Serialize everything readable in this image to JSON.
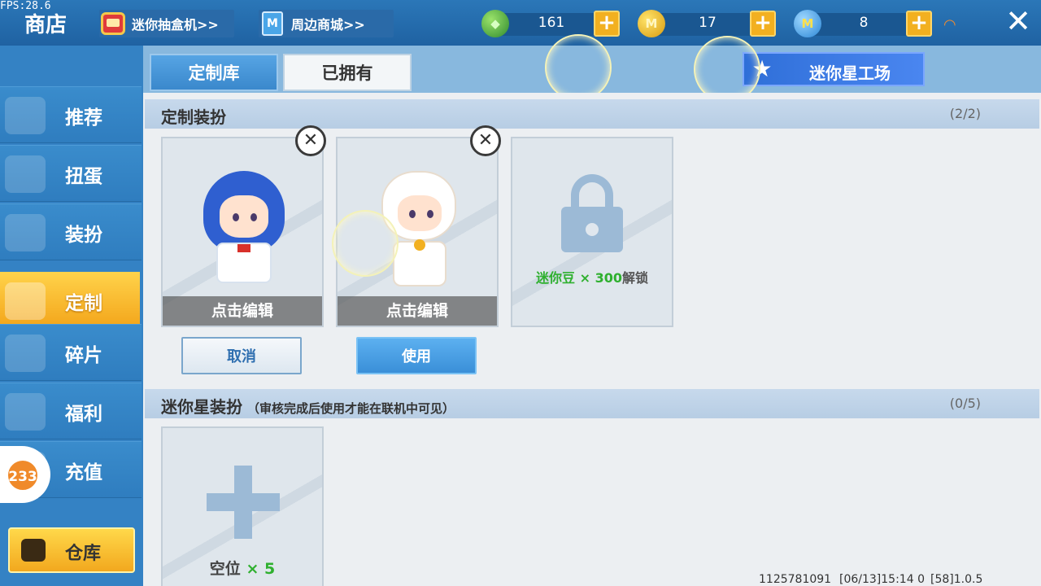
{
  "fps": "FPS:28.6",
  "header": {
    "title": "商店",
    "links": [
      {
        "label": "迷你抽盒机>>"
      },
      {
        "label": "周边商城>>"
      }
    ],
    "currencies": [
      {
        "name": "gem",
        "value": "161"
      },
      {
        "name": "gold",
        "value": "17"
      },
      {
        "name": "mini-coin",
        "value": "8"
      }
    ]
  },
  "sidebar": {
    "items": [
      {
        "label": "推荐"
      },
      {
        "label": "扭蛋"
      },
      {
        "label": "装扮"
      },
      {
        "label": "定制",
        "active": true
      },
      {
        "label": "碎片"
      },
      {
        "label": "福利"
      },
      {
        "label": "充值"
      }
    ],
    "badge": "233",
    "warehouse": "仓库"
  },
  "tabs": [
    {
      "label": "定制库",
      "active": true
    },
    {
      "label": "已拥有"
    }
  ],
  "studio_button": "迷你星工场",
  "custom_section": {
    "title": "定制装扮",
    "count": "(2/2)",
    "cards": [
      {
        "edit_label": "点击编辑"
      },
      {
        "edit_label": "点击编辑"
      }
    ],
    "locked_card": {
      "price": "迷你豆 × 300",
      "suffix": "解锁"
    },
    "cancel_label": "取消",
    "use_label": "使用"
  },
  "mini_section": {
    "title": "迷你星装扮",
    "note": "（审核完成后使用才能在联机中可见）",
    "count": "(0/5)",
    "empty_slot": {
      "label": "空位",
      "count": "× 5"
    }
  },
  "footer": {
    "uid": "1125781091",
    "time": "[06/13]15:14 0",
    "version": "[58]1.0.5"
  },
  "colors": {
    "topbar": "#2b77b8",
    "sidebar": "#3482c4",
    "active_tab": "#f3a51a",
    "accent_green": "#2fb02f"
  }
}
